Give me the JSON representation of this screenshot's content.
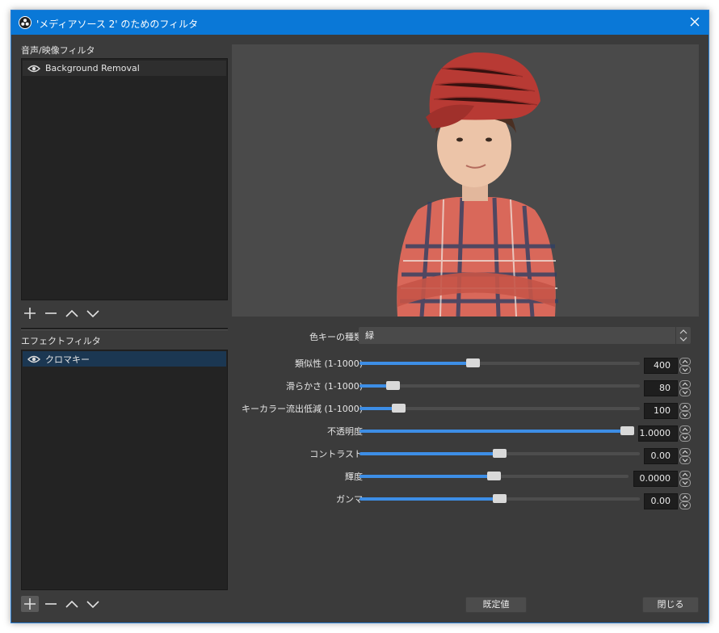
{
  "window": {
    "title": "'メディアソース 2' のためのフィルタ"
  },
  "audio_video_filters": {
    "label": "音声/映像フィルタ",
    "items": [
      {
        "name": "Background Removal"
      }
    ]
  },
  "effect_filters": {
    "label": "エフェクトフィルタ",
    "items": [
      {
        "name": "クロマキー"
      }
    ]
  },
  "properties": {
    "key_color_type": {
      "label": "色キーの種類",
      "value": "緑"
    },
    "sliders": [
      {
        "label": "類似性 (1-1000)",
        "value": "400",
        "fraction": 0.4
      },
      {
        "label": "滑らかさ (1-1000)",
        "value": "80",
        "fraction": 0.1
      },
      {
        "label": "キーカラー流出低減 (1-1000)",
        "value": "100",
        "fraction": 0.12
      },
      {
        "label": "不透明度",
        "value": "1.0000",
        "fraction": 1.0
      },
      {
        "label": "コントラスト",
        "value": "0.00",
        "fraction": 0.5
      },
      {
        "label": "輝度",
        "value": "0.0000",
        "fraction": 0.5
      },
      {
        "label": "ガンマ",
        "value": "0.00",
        "fraction": 0.5
      }
    ]
  },
  "buttons": {
    "defaults": "既定値",
    "close": "閉じる"
  },
  "colors": {
    "titlebar": "#0a78d7",
    "accent": "#3d8ee6",
    "background": "#3b3b3b",
    "selection": "#1b3752"
  }
}
